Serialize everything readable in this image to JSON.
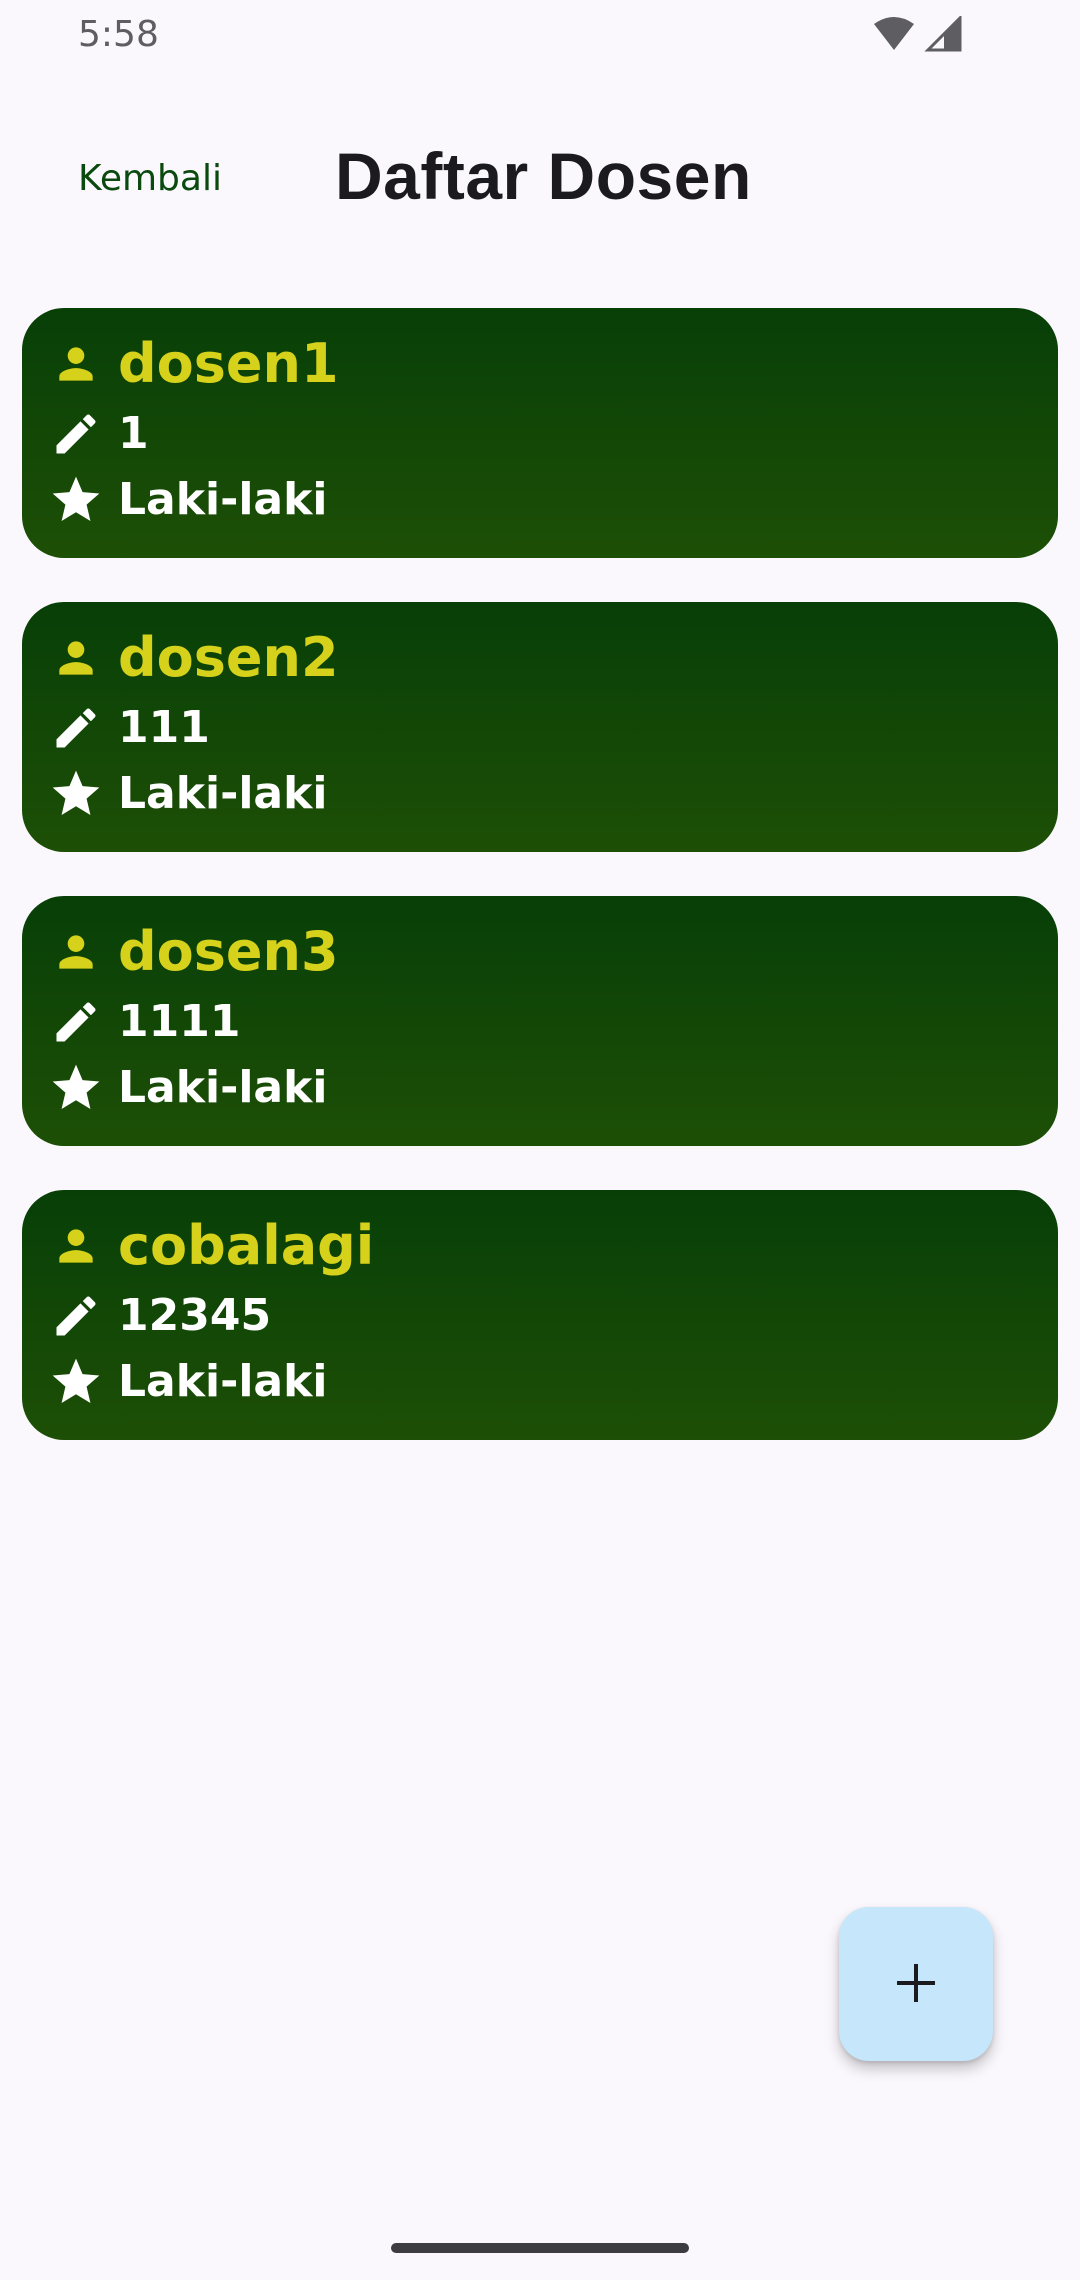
{
  "status_bar": {
    "time": "5:58",
    "icons": [
      "wifi-icon",
      "cellular-signal-icon"
    ]
  },
  "header": {
    "back_label": "Kembali",
    "title": "Daftar Dosen"
  },
  "colors": {
    "card_gradient_top": "#073F07",
    "card_gradient_bottom": "#1D4F06",
    "name_color": "#D6D11A",
    "detail_color": "#FFFFFF",
    "fab_background": "#C5E6FB",
    "back_label_color": "#0B4A0E"
  },
  "lecturers": [
    {
      "name": "dosen1",
      "nip": "1",
      "gender": "Laki-laki"
    },
    {
      "name": "dosen2",
      "nip": "111",
      "gender": "Laki-laki"
    },
    {
      "name": "dosen3",
      "nip": "1111",
      "gender": "Laki-laki"
    },
    {
      "name": "cobalagi",
      "nip": "12345",
      "gender": "Laki-laki"
    }
  ],
  "fab": {
    "icon": "plus-icon"
  }
}
